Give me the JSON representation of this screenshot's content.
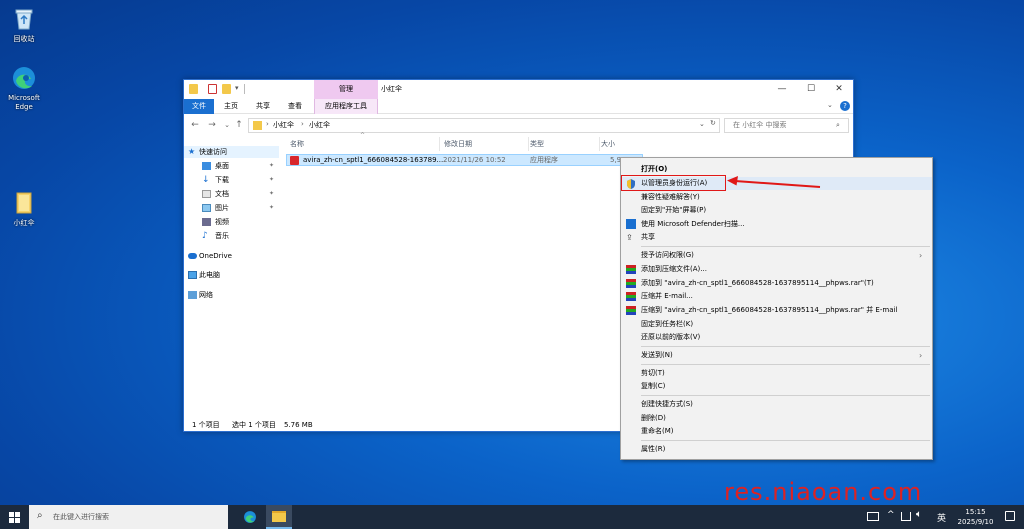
{
  "desktop": {
    "icons": [
      {
        "label": "回收站",
        "icon": "recycle-bin-icon"
      },
      {
        "label": "Microsoft Edge",
        "icon": "edge-icon"
      },
      {
        "label": "小红伞",
        "icon": "folder-icon"
      }
    ]
  },
  "explorer": {
    "context_tab_header": "管理",
    "title": "小红伞",
    "controls": {
      "minimize": "—",
      "maximize": "☐",
      "close": "✕"
    },
    "ribbon_tabs": [
      "文件",
      "主页",
      "共享",
      "查看",
      "应用程序工具"
    ],
    "address_path": [
      "小红伞",
      "小红伞"
    ],
    "search_placeholder": "在 小红伞 中搜索",
    "sidebar": [
      {
        "label": "快速访问",
        "icon": "star-icon",
        "pinned": false
      },
      {
        "label": "桌面",
        "icon": "desktop-icon",
        "pinned": true
      },
      {
        "label": "下载",
        "icon": "download-icon",
        "pinned": true
      },
      {
        "label": "文档",
        "icon": "document-icon",
        "pinned": true
      },
      {
        "label": "图片",
        "icon": "picture-icon",
        "pinned": true
      },
      {
        "label": "视频",
        "icon": "video-icon",
        "pinned": false
      },
      {
        "label": "音乐",
        "icon": "music-icon",
        "pinned": false
      },
      {
        "label": "OneDrive",
        "icon": "cloud-icon",
        "pinned": false
      },
      {
        "label": "此电脑",
        "icon": "computer-icon",
        "pinned": false
      },
      {
        "label": "网络",
        "icon": "network-icon",
        "pinned": false
      }
    ],
    "columns": [
      "名称",
      "修改日期",
      "类型",
      "大小"
    ],
    "files": [
      {
        "name": "avira_zh-cn_sptl1_666084528-163789...",
        "modified": "2021/11/26 10:52",
        "type": "应用程序",
        "size": "5,9"
      }
    ],
    "status": {
      "count": "1 个项目",
      "selected": "选中 1 个项目",
      "size": "5.76 MB"
    }
  },
  "context_menu": {
    "items": [
      {
        "label": "打开(O)",
        "bold": true
      },
      {
        "label": "以管理员身份运行(A)",
        "icon": "shield-icon",
        "highlighted": true
      },
      {
        "label": "兼容性疑难解答(Y)"
      },
      {
        "label": "固定到\"开始\"屏幕(P)"
      },
      {
        "label": "使用 Microsoft Defender扫描...",
        "icon": "defender-icon"
      },
      {
        "label": "共享",
        "icon": "share-icon"
      },
      {
        "sep": true
      },
      {
        "label": "授予访问权限(G)",
        "submenu": true
      },
      {
        "label": "添加到压缩文件(A)...",
        "icon": "winrar-icon"
      },
      {
        "label": "添加到 \"avira_zh-cn_sptl1_666084528-1637895114__phpws.rar\"(T)",
        "icon": "winrar-icon"
      },
      {
        "label": "压缩并 E-mail...",
        "icon": "winrar-icon"
      },
      {
        "label": "压缩到 \"avira_zh-cn_sptl1_666084528-1637895114__phpws.rar\" 并 E-mail",
        "icon": "winrar-icon"
      },
      {
        "label": "固定到任务栏(K)"
      },
      {
        "label": "还原以前的版本(V)"
      },
      {
        "sep": true
      },
      {
        "label": "发送到(N)",
        "submenu": true
      },
      {
        "sep": true
      },
      {
        "label": "剪切(T)"
      },
      {
        "label": "复制(C)"
      },
      {
        "sep": true
      },
      {
        "label": "创建快捷方式(S)"
      },
      {
        "label": "删除(D)"
      },
      {
        "label": "重命名(M)"
      },
      {
        "sep": true
      },
      {
        "label": "属性(R)"
      }
    ]
  },
  "taskbar": {
    "search_placeholder": "在此键入进行搜索",
    "ime": "英",
    "time": "15:15",
    "date": "2025/9/10"
  },
  "watermark": "res.niaoan.com",
  "colors": {
    "accent": "#1a6fd0",
    "highlight_box": "#e01818",
    "selection": "#cce8ff"
  }
}
